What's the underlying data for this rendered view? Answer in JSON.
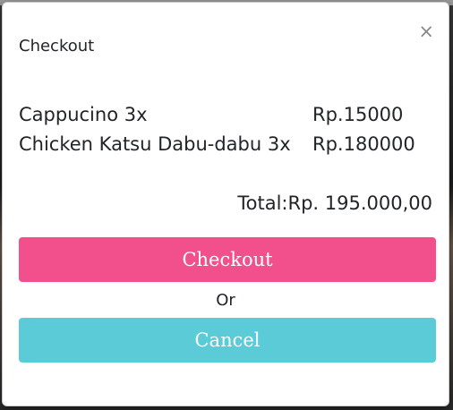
{
  "modal": {
    "title": "Checkout",
    "close_label": "×"
  },
  "cart": {
    "items": [
      {
        "name": "Cappucino 3x",
        "price": "Rp.15000"
      },
      {
        "name": "Chicken Katsu Dabu-dabu 3x",
        "price": "Rp.180000"
      }
    ],
    "total": "Total:Rp. 195.000,00"
  },
  "actions": {
    "checkout_label": "Checkout",
    "or_label": "Or",
    "cancel_label": "Cancel"
  },
  "colors": {
    "checkout_button": "#f2508c",
    "cancel_button": "#5bcbd8"
  },
  "icons": {
    "close": "close-icon"
  }
}
